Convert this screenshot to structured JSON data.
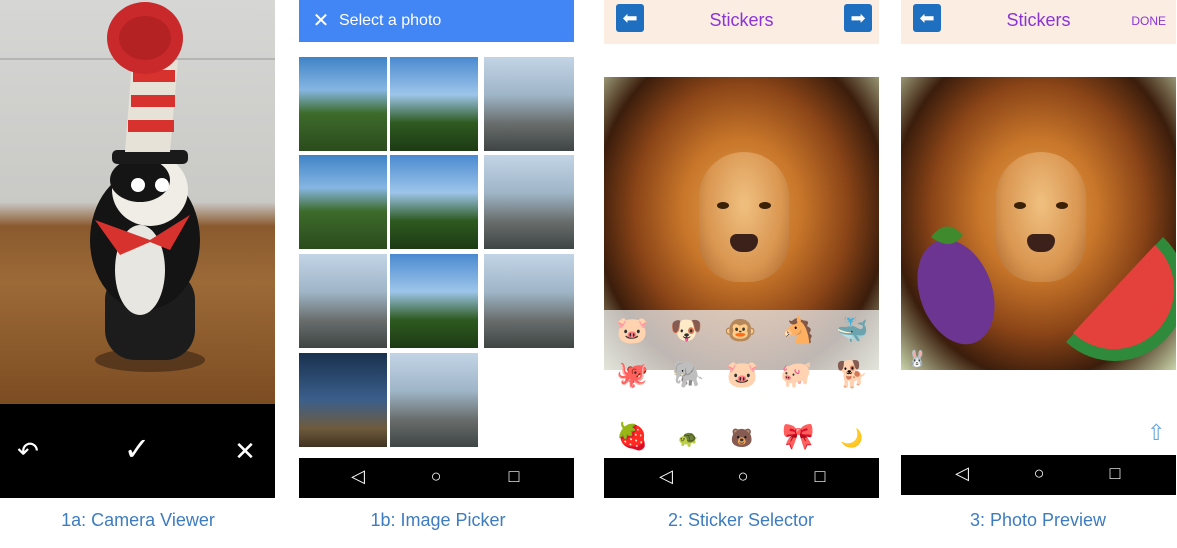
{
  "captions": {
    "camera": "1a: Camera Viewer",
    "picker": "1b: Image Picker",
    "sticker_selector": "2: Sticker Selector",
    "photo_preview": "3: Photo Preview"
  },
  "camera": {
    "retake_icon": "undo-icon",
    "accept_icon": "check-icon",
    "cancel_icon": "close-icon"
  },
  "picker": {
    "title": "Select a photo",
    "close_icon": "close-icon",
    "thumbnail_count": 11
  },
  "sticker_selector": {
    "title": "Stickers",
    "back_icon": "arrow-left-icon",
    "next_icon": "arrow-right-icon",
    "row1": [
      "pig-icon",
      "dog-icon",
      "monkey-icon",
      "horse-icon",
      "whale-icon"
    ],
    "row2": [
      "octopus-icon",
      "elephant-icon",
      "pig-face-icon",
      "pig-icon",
      "dog-icon"
    ],
    "row3": [
      "strawberry-icon",
      "turtle-icon",
      "bear-icon",
      "bow-icon",
      "moon-icon"
    ]
  },
  "photo_preview": {
    "title": "Stickers",
    "back_icon": "arrow-left-icon",
    "done_label": "DONE",
    "share_icon": "share-icon"
  },
  "nav": {
    "back_icon": "back-triangle-icon",
    "home_icon": "home-circle-icon",
    "recents_icon": "recents-square-icon"
  },
  "colors": {
    "picker_header": "#4285f4",
    "sticker_title": "#8a34d8",
    "caption": "#3d7cc0",
    "arrow_button": "#1e6fc0"
  }
}
